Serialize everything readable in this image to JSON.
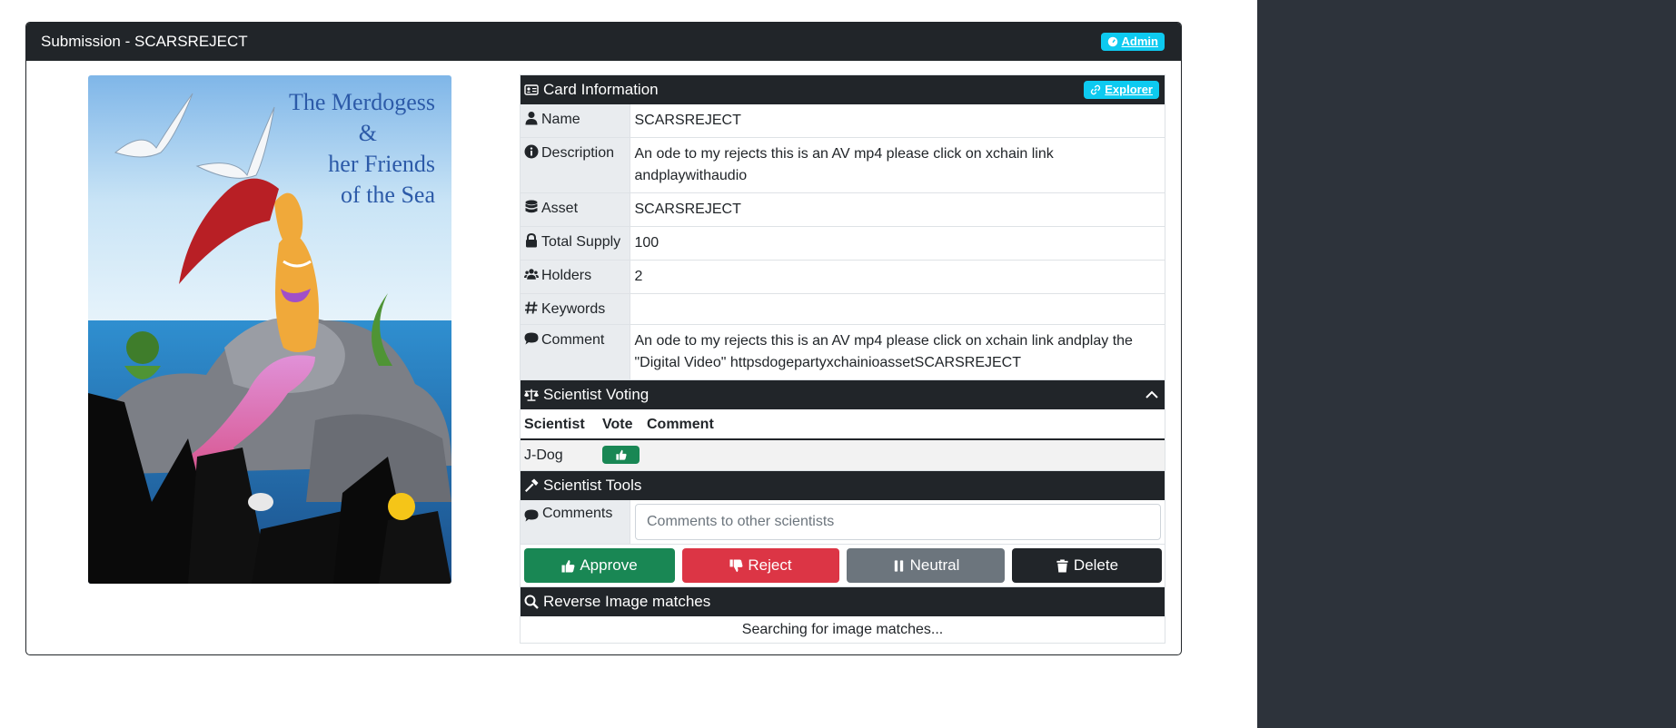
{
  "header": {
    "title": "Submission - SCARSREJECT",
    "admin_link": "Admin"
  },
  "poster": {
    "title_line1": "The Merdogess",
    "title_line2": "&",
    "title_line3": "her Friends",
    "title_line4": "of the Sea"
  },
  "card_info": {
    "title": "Card Information",
    "explorer_link": "Explorer",
    "rows": [
      {
        "label": "Name",
        "icon": "user-icon",
        "value": "SCARSREJECT"
      },
      {
        "label": "Description",
        "icon": "info-circle-icon",
        "value": "An ode to my rejects this is an AV mp4 please click on xchain link andplaywithaudio"
      },
      {
        "label": "Asset",
        "icon": "database-icon",
        "value": "SCARSREJECT"
      },
      {
        "label": "Total Supply",
        "icon": "lock-icon",
        "value": "100"
      },
      {
        "label": "Holders",
        "icon": "users-icon",
        "value": "2"
      },
      {
        "label": "Keywords",
        "icon": "hashtag-icon",
        "value": ""
      },
      {
        "label": "Comment",
        "icon": "comment-icon",
        "value": "An ode to my rejects this is an AV mp4 please click on xchain link andplay the \"Digital Video\" httpsdogepartyxchainioassetSCARSREJECT"
      }
    ]
  },
  "voting": {
    "title": "Scientist Voting",
    "columns": [
      "Scientist",
      "Vote",
      "Comment"
    ],
    "rows": [
      {
        "scientist": "J-Dog",
        "vote": "approve",
        "comment": ""
      }
    ]
  },
  "tools": {
    "title": "Scientist Tools",
    "comments_label": "Comments",
    "comments_placeholder": "Comments to other scientists",
    "approve_label": "Approve",
    "reject_label": "Reject",
    "neutral_label": "Neutral",
    "delete_label": "Delete"
  },
  "reverse_image": {
    "title": "Reverse Image matches",
    "status": "Searching for image matches..."
  },
  "colors": {
    "dark": "#212529",
    "info": "#0dcaf0",
    "success": "#198754",
    "danger": "#dc3545",
    "secondary": "#6c757d",
    "sidebar": "#2d333b"
  }
}
